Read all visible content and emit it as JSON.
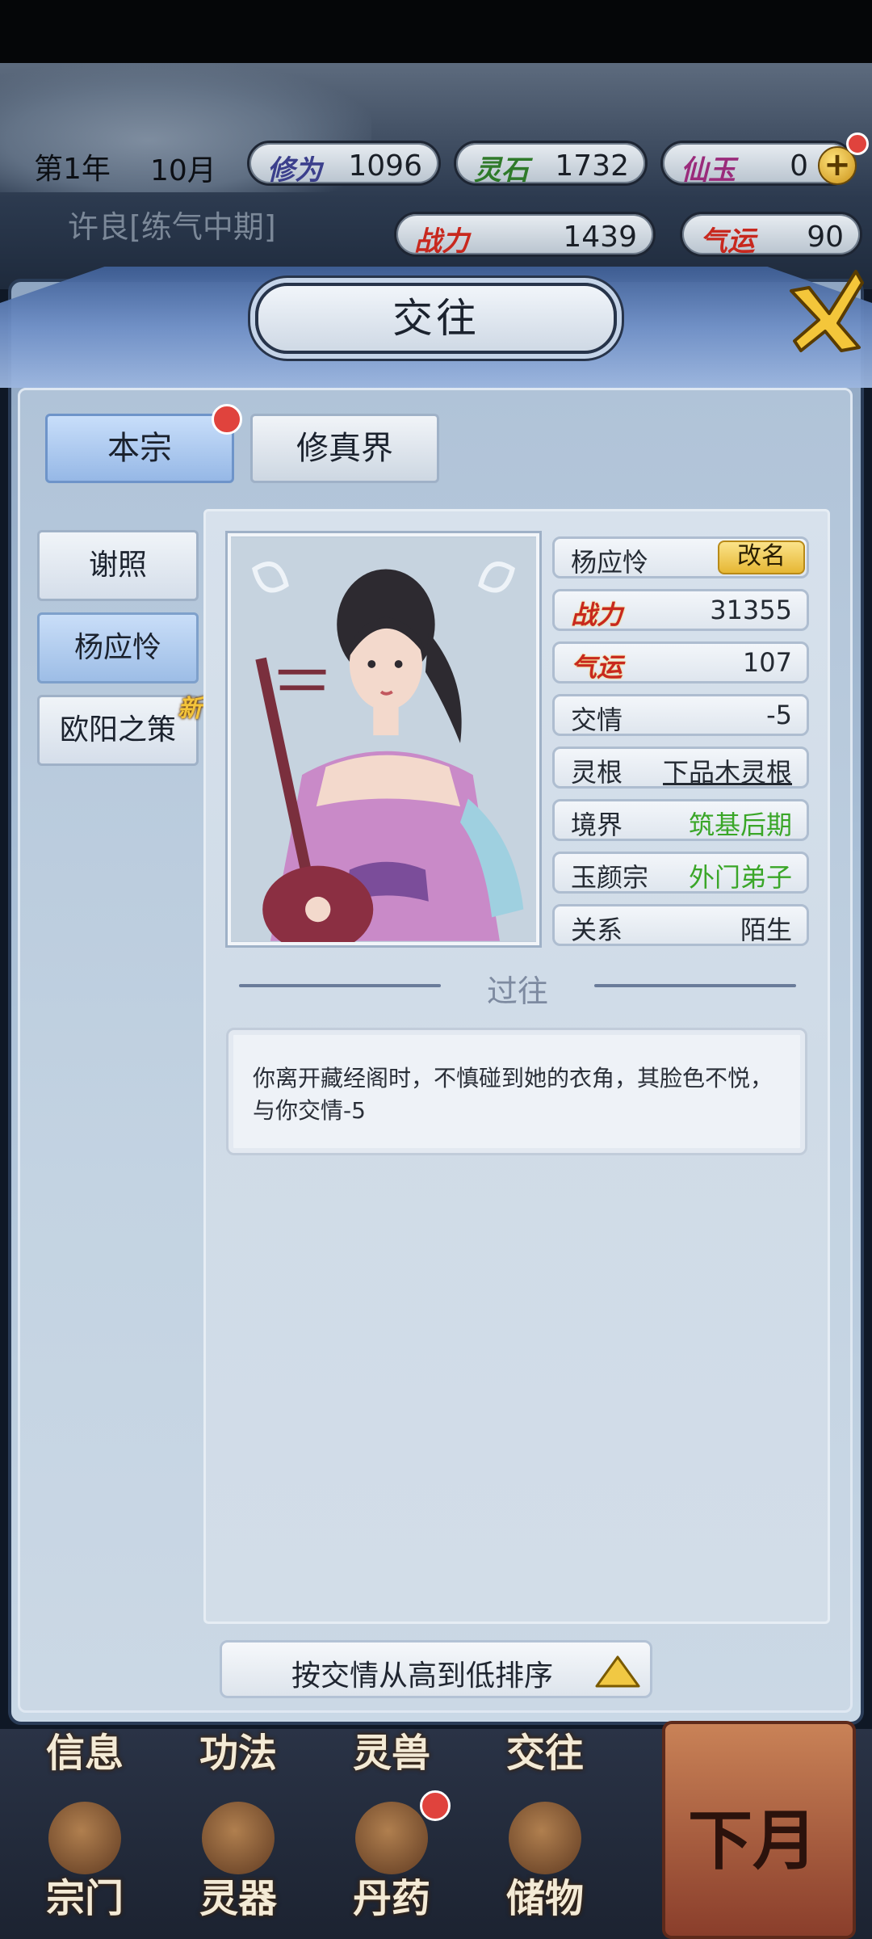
{
  "header": {
    "year": "第1年",
    "month": "10月",
    "player_name": "许良[练气中期]",
    "stats": [
      {
        "label": "修为",
        "value": "1096",
        "color": "#3b3f8c"
      },
      {
        "label": "灵石",
        "value": "1732",
        "color": "#2f7a2a"
      },
      {
        "label": "仙玉",
        "value": "0",
        "color": "#9a2b7b"
      },
      {
        "label": "战力",
        "value": "1439",
        "color": "#c8281e"
      },
      {
        "label": "气运",
        "value": "90",
        "color": "#c8281e"
      }
    ],
    "plus_symbol": "+"
  },
  "dialog": {
    "title": "交往",
    "close_icon": "close-x-icon"
  },
  "tabs": [
    {
      "label": "本宗",
      "active": true
    },
    {
      "label": "修真界",
      "active": false
    }
  ],
  "people": [
    {
      "name": "谢照",
      "active": false
    },
    {
      "name": "杨应怜",
      "active": true
    },
    {
      "name": "欧阳之策",
      "active": false,
      "badge": "新"
    }
  ],
  "detail": {
    "name": "杨应怜",
    "rename_label": "改名",
    "rows": [
      {
        "key": "战力",
        "value": "31355"
      },
      {
        "key": "气运",
        "value": "107"
      },
      {
        "key": "交情",
        "value": "-5"
      },
      {
        "key": "灵根",
        "value": "下品木灵根"
      },
      {
        "key": "境界",
        "value": "筑基后期"
      },
      {
        "key": "玉颜宗",
        "value": "外门弟子"
      },
      {
        "key": "关系",
        "value": "陌生"
      }
    ],
    "history_title": "过往",
    "history_text": "你离开藏经阁时，不慎碰到她的衣角，其脸色不悦，与你交情-5"
  },
  "sort_button": "按交情从高到低排序",
  "bottom_nav": [
    {
      "label": "信息"
    },
    {
      "label": "功法"
    },
    {
      "label": "灵兽"
    },
    {
      "label": "交往"
    },
    {
      "label": "宗门"
    },
    {
      "label": "灵器"
    },
    {
      "label": "丹药"
    },
    {
      "label": "储物"
    }
  ],
  "next_month": "下月",
  "colors": {
    "accent_blue": "#6e94c9",
    "value_green": "#3aa628",
    "fire_red": "#c8281e",
    "badge_gold": "#f3c43b"
  }
}
